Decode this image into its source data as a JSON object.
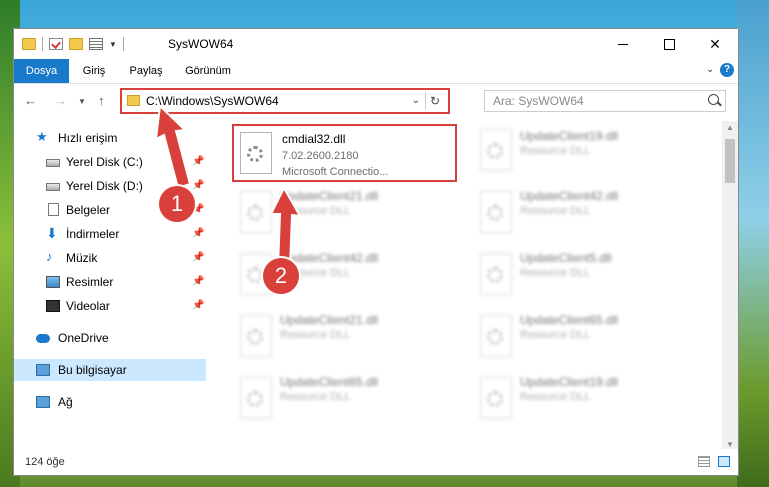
{
  "window": {
    "title": "SysWOW64",
    "icons": [
      "folder-icon",
      "properties-icon",
      "new-folder-icon"
    ]
  },
  "ribbon": {
    "tabs": [
      {
        "label": "Dosya"
      },
      {
        "label": "Giriş"
      },
      {
        "label": "Paylaş"
      },
      {
        "label": "Görünüm"
      }
    ],
    "help": "?"
  },
  "address": {
    "path": "C:\\Windows\\SysWOW64",
    "search_placeholder": "Ara: SysWOW64"
  },
  "nav": {
    "items": [
      {
        "label": "Hızlı erişim",
        "icon": "star-icon"
      },
      {
        "label": "Yerel Disk (C:)",
        "icon": "drive-icon",
        "pinned": true
      },
      {
        "label": "Yerel Disk (D:)",
        "icon": "drive-icon",
        "pinned": true
      },
      {
        "label": "Belgeler",
        "icon": "document-icon",
        "pinned": true
      },
      {
        "label": "İndirmeler",
        "icon": "download-icon",
        "pinned": true
      },
      {
        "label": "Müzik",
        "icon": "music-icon",
        "pinned": true
      },
      {
        "label": "Resimler",
        "icon": "pictures-icon",
        "pinned": true
      },
      {
        "label": "Videolar",
        "icon": "videos-icon",
        "pinned": true
      },
      {
        "label": "OneDrive",
        "icon": "cloud-icon"
      },
      {
        "label": "Bu bilgisayar",
        "icon": "computer-icon",
        "selected": true
      },
      {
        "label": "Ağ",
        "icon": "network-icon"
      }
    ]
  },
  "files": {
    "highlighted": {
      "name": "cmdial32.dll",
      "version": "7.02.2600.2180",
      "description": "Microsoft Connectio..."
    },
    "blurred_left": [
      {
        "name": "UpdateClient21.dll",
        "type": "Resource DLL"
      },
      {
        "name": "UpdateClient42.dll",
        "type": "Resource DLL"
      },
      {
        "name": "UpdateClient21.dll",
        "type": "Resource DLL"
      },
      {
        "name": "UpdateClient65.dll",
        "type": "Resource DLL"
      }
    ],
    "blurred_right": [
      {
        "name": "UpdateClient19.dll",
        "type": "Resource DLL"
      },
      {
        "name": "UpdateClient42.dll",
        "type": "Resource DLL"
      },
      {
        "name": "UpdateClient5.dll",
        "type": "Resource DLL"
      },
      {
        "name": "UpdateClient65.dll",
        "type": "Resource DLL"
      },
      {
        "name": "UpdateClient19.dll",
        "type": "Resource DLL"
      }
    ]
  },
  "status": {
    "count": "124 öğe"
  },
  "annotations": {
    "step1": "1",
    "step2": "2",
    "color": "#d9403c"
  }
}
